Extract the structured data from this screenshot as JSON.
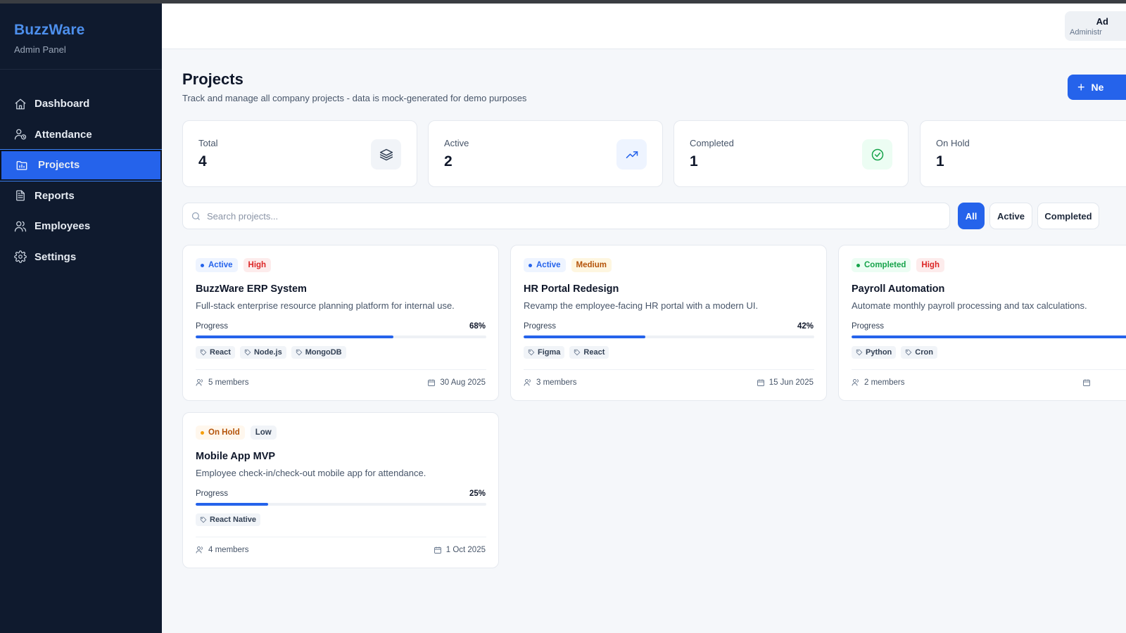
{
  "sidebar": {
    "brand": "BuzzWare",
    "subtitle": "Admin Panel",
    "items": [
      {
        "label": "Dashboard",
        "icon": "home-icon"
      },
      {
        "label": "Attendance",
        "icon": "user-clock-icon"
      },
      {
        "label": "Projects",
        "icon": "folder-icon",
        "active": true
      },
      {
        "label": "Reports",
        "icon": "file-text-icon"
      },
      {
        "label": "Employees",
        "icon": "users-icon"
      },
      {
        "label": "Settings",
        "icon": "gear-icon"
      }
    ]
  },
  "header": {
    "user_name": "Ad",
    "user_role": "Administr"
  },
  "page": {
    "title": "Projects",
    "subtitle": "Track and manage all company projects - data is mock-generated for demo purposes",
    "new_button": "Ne"
  },
  "stats": [
    {
      "label": "Total",
      "value": "4",
      "icon": "layers-icon",
      "icon_bg": "#f1f4f8",
      "icon_color": "#334155"
    },
    {
      "label": "Active",
      "value": "2",
      "icon": "trending-up-icon",
      "icon_bg": "#eef4ff",
      "icon_color": "#2563eb"
    },
    {
      "label": "Completed",
      "value": "1",
      "icon": "check-circle-icon",
      "icon_bg": "#ecfdf3",
      "icon_color": "#16a34a"
    },
    {
      "label": "On Hold",
      "value": "1",
      "icon": "",
      "icon_bg": "#fff7ed",
      "icon_color": "#d97706"
    }
  ],
  "search": {
    "placeholder": "Search projects..."
  },
  "filters": [
    {
      "label": "All",
      "active": true
    },
    {
      "label": "Active",
      "active": false
    },
    {
      "label": "Completed",
      "active": false
    }
  ],
  "projects": [
    {
      "status": "Active",
      "priority": "High",
      "title": "BuzzWare ERP System",
      "description": "Full-stack enterprise resource planning platform for internal use.",
      "progress_label": "Progress",
      "progress_text": "68%",
      "progress": 0.68,
      "tags": [
        "React",
        "Node.js",
        "MongoDB"
      ],
      "members": "5 members",
      "due": "30 Aug 2025"
    },
    {
      "status": "Active",
      "priority": "Medium",
      "title": "HR Portal Redesign",
      "description": "Revamp the employee-facing HR portal with a modern UI.",
      "progress_label": "Progress",
      "progress_text": "42%",
      "progress": 0.42,
      "tags": [
        "Figma",
        "React"
      ],
      "members": "3 members",
      "due": "15 Jun 2025"
    },
    {
      "status": "Completed",
      "priority": "High",
      "title": "Payroll Automation",
      "description": "Automate monthly payroll processing and tax calculations.",
      "progress_label": "Progress",
      "progress_text": "",
      "progress": 1.0,
      "tags": [
        "Python",
        "Cron"
      ],
      "members": "2 members",
      "due": ""
    },
    {
      "status": "On Hold",
      "priority": "Low",
      "title": "Mobile App MVP",
      "description": "Employee check-in/check-out mobile app for attendance.",
      "progress_label": "Progress",
      "progress_text": "25%",
      "progress": 0.25,
      "tags": [
        "React Native"
      ],
      "members": "4 members",
      "due": "1 Oct 2025"
    }
  ],
  "colors": {
    "accent": "#2563eb",
    "sidebar_bg": "#0f1a2e",
    "brand": "#4d8fec",
    "status_active": {
      "bg": "#eef4ff",
      "fg": "#2563eb"
    },
    "status_completed": {
      "bg": "#ecfdf3",
      "fg": "#16a34a"
    },
    "status_onhold": {
      "bg": "#fff7ed",
      "fg": "#b45309",
      "dot": "#f59e0b"
    },
    "priority_high": {
      "bg": "#fdecec",
      "fg": "#dc2626"
    },
    "priority_medium": {
      "bg": "#fef6e0",
      "fg": "#b45309"
    },
    "priority_low": {
      "bg": "#f1f4f8",
      "fg": "#334155"
    }
  }
}
